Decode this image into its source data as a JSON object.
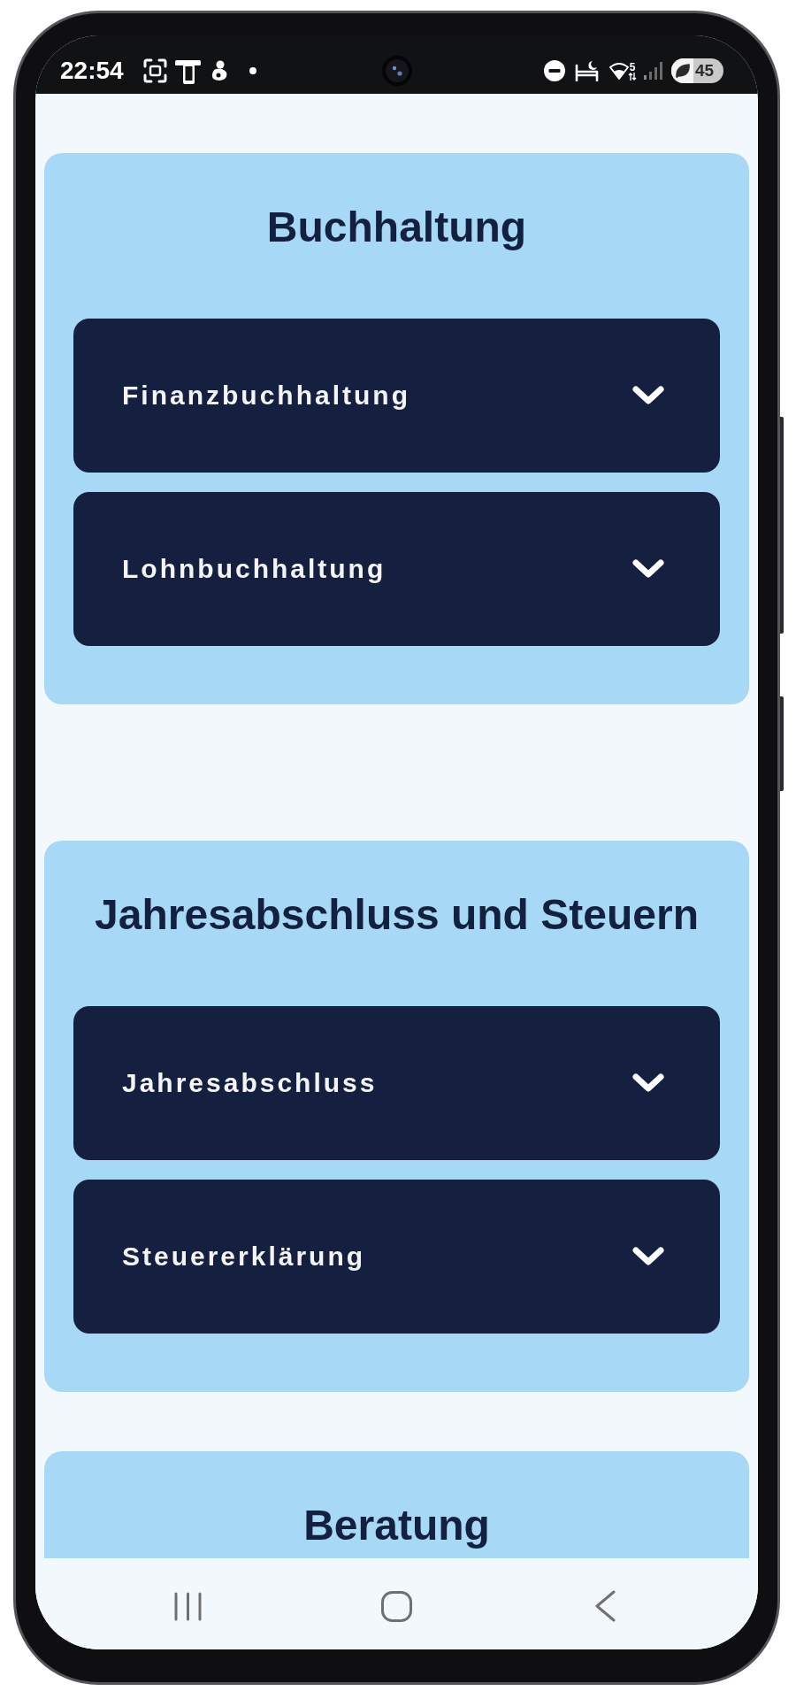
{
  "status_bar": {
    "time": "22:54",
    "wifi_badge": "5",
    "battery": "45"
  },
  "sections": [
    {
      "title": "Buchhaltung",
      "items": [
        {
          "label": "Finanzbuchhaltung",
          "expanded": false
        },
        {
          "label": "Lohnbuchhaltung",
          "expanded": false
        }
      ]
    },
    {
      "title": "Jahresabschluss und Steuern",
      "items": [
        {
          "label": "Jahresabschluss",
          "expanded": false
        },
        {
          "label": "Steuererklärung",
          "expanded": false
        }
      ]
    },
    {
      "title": "Beratung"
    }
  ]
}
